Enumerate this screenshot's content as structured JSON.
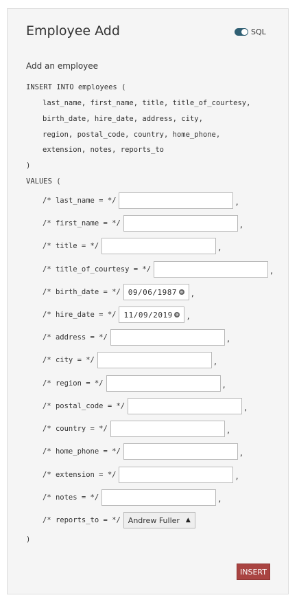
{
  "header": {
    "title": "Employee Add",
    "sql_toggle_label": "SQL"
  },
  "subtitle": "Add an employee",
  "sql": {
    "insert_line": "INSERT INTO employees (",
    "columns_lines": [
      "last_name, first_name, title, title_of_courtesy,",
      "birth_date, hire_date, address, city,",
      "region, postal_code, country, home_phone,",
      "extension, notes, reports_to"
    ],
    "close_paren": ")",
    "values_line": "VALUES (",
    "end_paren": ")",
    "comma": ","
  },
  "fields": [
    {
      "label": "/* last_name = */",
      "value": ""
    },
    {
      "label": "/* first_name = */",
      "value": ""
    },
    {
      "label": "/* title = */",
      "value": ""
    },
    {
      "label": "/* title_of_courtesy = */",
      "value": ""
    },
    {
      "label": "/* birth_date = */",
      "value": "09/06/1987"
    },
    {
      "label": "/* hire_date = */",
      "value": "11/09/2019"
    },
    {
      "label": "/* address = */",
      "value": ""
    },
    {
      "label": "/* city = */",
      "value": ""
    },
    {
      "label": "/* region = */",
      "value": ""
    },
    {
      "label": "/* postal_code = */",
      "value": ""
    },
    {
      "label": "/* country = */",
      "value": ""
    },
    {
      "label": "/* home_phone = */",
      "value": ""
    },
    {
      "label": "/* extension = */",
      "value": ""
    },
    {
      "label": "/* notes = */",
      "value": ""
    },
    {
      "label": "/* reports_to = */",
      "value": "Andrew Fuller"
    }
  ],
  "icons": {
    "clear": "⊗",
    "dropdown": "▲"
  },
  "insert_button": "INSERT",
  "colors": {
    "accent": "#2f5f73",
    "insert": "#a94442"
  }
}
